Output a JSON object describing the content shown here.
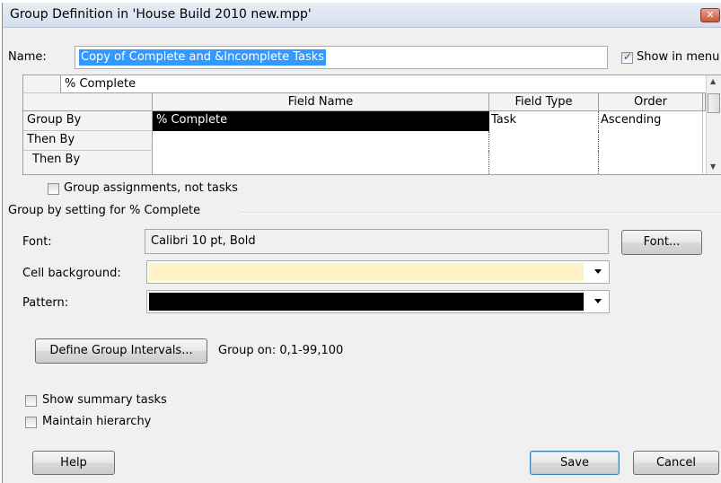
{
  "window": {
    "title": "Group Definition in 'House Build 2010 new.mpp'",
    "close_glyph": "✕"
  },
  "name_row": {
    "label": "Name:",
    "value": "Copy of Complete and &Incomplete Tasks",
    "show_in_menu_label": "Show in menu",
    "show_in_menu_checked": true
  },
  "grid": {
    "edit_value": "% Complete",
    "headers": [
      "Field Name",
      "Field Type",
      "Order"
    ],
    "rows": [
      {
        "label": "Group By",
        "field": "% Complete",
        "type": "Task",
        "order": "Ascending"
      },
      {
        "label": "Then By",
        "field": "",
        "type": "",
        "order": ""
      },
      {
        "label": "Then By",
        "field": "",
        "type": "",
        "order": ""
      }
    ]
  },
  "group_assignments": {
    "label": "Group assignments, not tasks",
    "checked": false
  },
  "settings": {
    "section_title": "Group by setting for % Complete",
    "font_label": "Font:",
    "font_value": "Calibri 10 pt, Bold",
    "font_button": "Font...",
    "cell_background_label": "Cell background:",
    "cell_background_color": "#fff2c6",
    "pattern_label": "Pattern:",
    "pattern_color": "#000000"
  },
  "intervals": {
    "button": "Define Group Intervals...",
    "group_on": "Group on: 0,1-99,100"
  },
  "options": {
    "show_summary_label": "Show summary tasks",
    "show_summary_checked": false,
    "maintain_hierarchy_label": "Maintain hierarchy",
    "maintain_hierarchy_checked": false
  },
  "footer": {
    "help_button": "Help",
    "save_button": "Save",
    "cancel_button": "Cancel"
  }
}
